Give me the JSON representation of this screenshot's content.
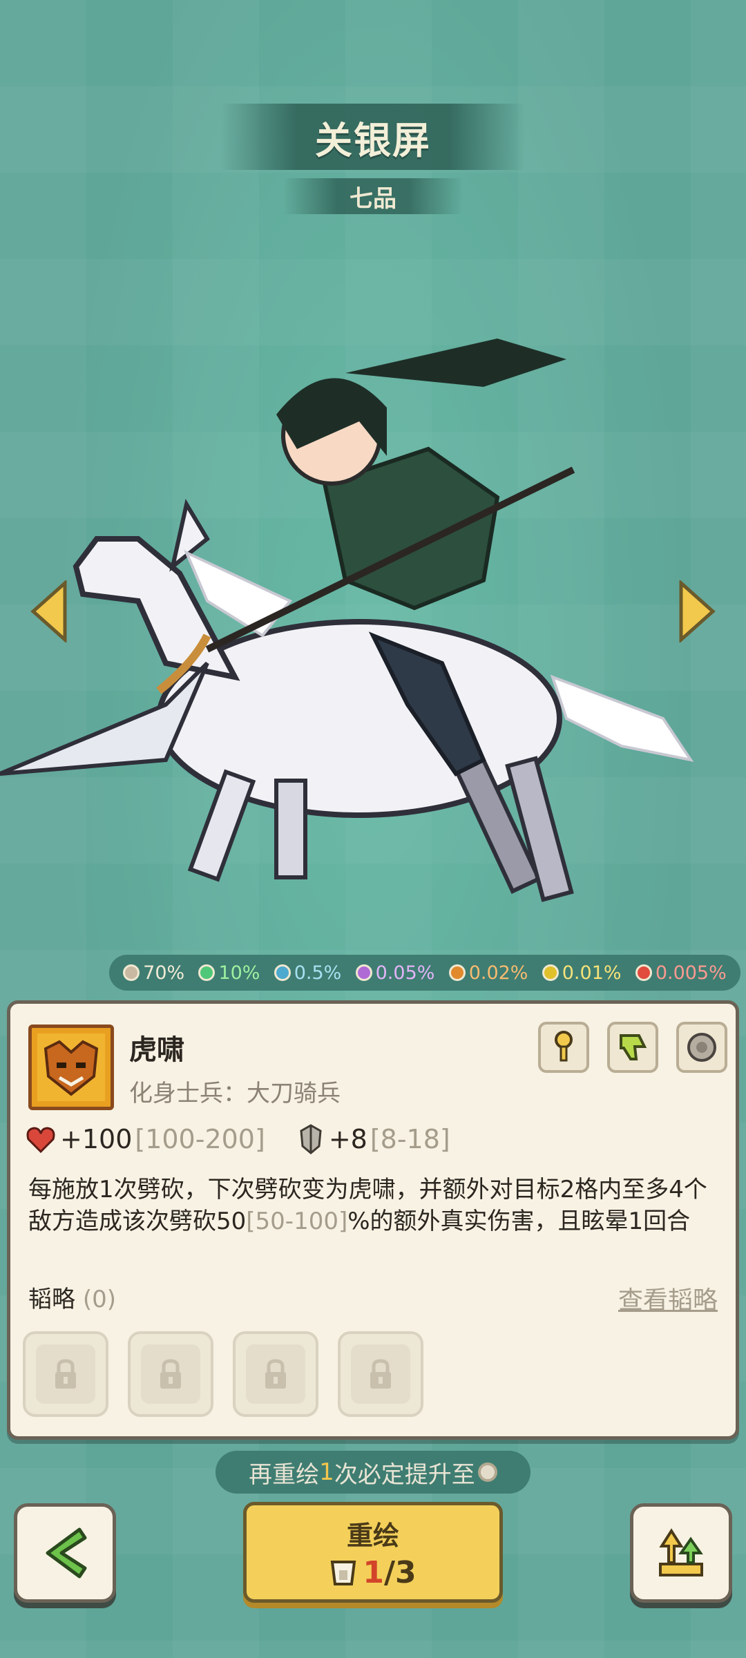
{
  "hero": {
    "name": "关银屏",
    "rank": "七品"
  },
  "rates": [
    {
      "value": "70%",
      "color": "#f1ead6",
      "dot": "#c9b9a3"
    },
    {
      "value": "10%",
      "color": "#9ef0a0",
      "dot": "#4fc779"
    },
    {
      "value": "0.5%",
      "color": "#a6e1f2",
      "dot": "#4ea9cf"
    },
    {
      "value": "0.05%",
      "color": "#e2b4f7",
      "dot": "#b06ad6"
    },
    {
      "value": "0.02%",
      "color": "#f8bb70",
      "dot": "#e1892d"
    },
    {
      "value": "0.01%",
      "color": "#f6e27a",
      "dot": "#e0c12c"
    },
    {
      "value": "0.005%",
      "color": "#fb9a91",
      "dot": "#e04b3e"
    }
  ],
  "skill": {
    "name": "虎啸",
    "subtitle": "化身士兵：大刀骑兵",
    "hp": "+100",
    "hp_range": "[100-200]",
    "atk": "+8",
    "atk_range": "[8-18]",
    "desc_a": "每施放1次劈砍，下次劈砍变为虎啸，并额外对目标2格内至多4个敌方造成该次劈砍",
    "desc_value": "50",
    "desc_range": "[50-100]",
    "desc_b": "%的额外真实伤害，且眩晕1回合"
  },
  "tactics": {
    "label": "韬略",
    "count": "(0)",
    "view_link": "查看韬略"
  },
  "hint": {
    "prefix": "再重绘",
    "count": "1",
    "suffix": "次必定提升至"
  },
  "redraw": {
    "label": "重绘",
    "current": "1",
    "total": "/3"
  },
  "icons": {
    "card_buttons": [
      "key-icon",
      "thumb-down-icon",
      "record-icon"
    ],
    "back": "chevron-left-icon",
    "upgrade": "upgrade-arrows-icon"
  }
}
